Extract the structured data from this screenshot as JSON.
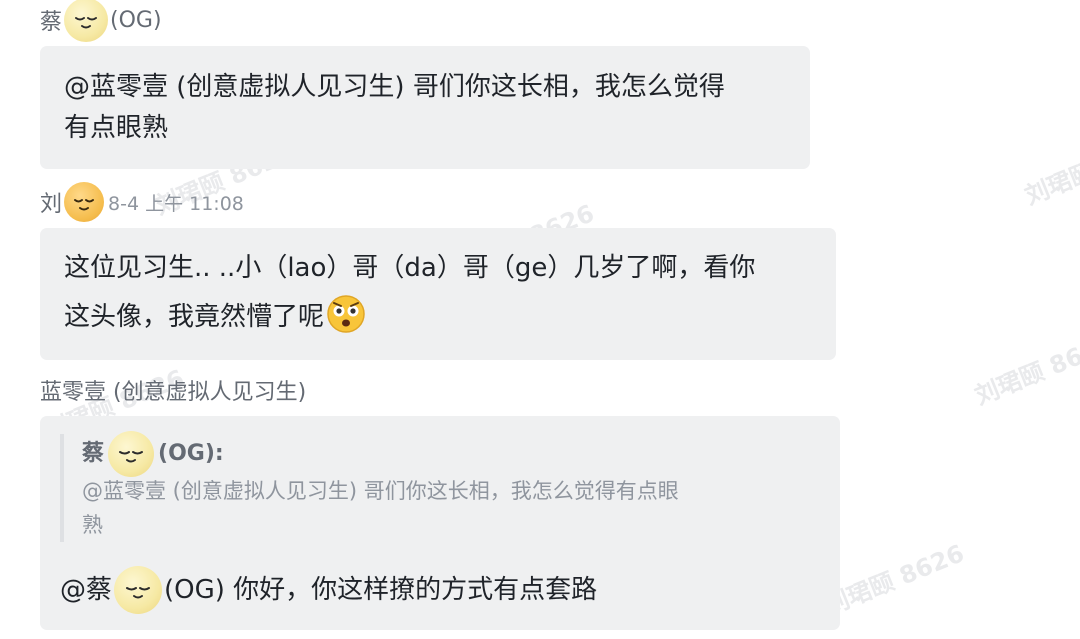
{
  "watermark": "刘珺颐 8626",
  "messages": [
    {
      "sender_prefix": "蔡",
      "sender_suffix": "(OG)",
      "avatar_icon": "smiling-face-emoji",
      "lines": [
        "@蓝零壹 (创意虚拟人见习生) 哥们你这长相，我怎么觉得",
        "有点眼熟"
      ]
    },
    {
      "sender_prefix": "刘",
      "avatar_icon": "smiling-face-emoji",
      "time": "8-4 上午 11:08",
      "line1": "这位见习生.. ..小（lao）哥（da）哥（ge）几岁了啊，看你",
      "line2": "这头像，我竟然懵了呢",
      "reaction_icon": "dizzy-face-emoji"
    },
    {
      "sender": "蓝零壹 (创意虚拟人见习生)",
      "quote_sender_prefix": "蔡",
      "quote_sender_suffix": "(OG):",
      "quote_lines": [
        "@蓝零壹 (创意虚拟人见习生) 哥们你这长相，我怎么觉得有点眼",
        "熟"
      ],
      "reply_prefix": "@蔡",
      "reply_text": "(OG) 你好，你这样撩的方式有点套路"
    }
  ]
}
